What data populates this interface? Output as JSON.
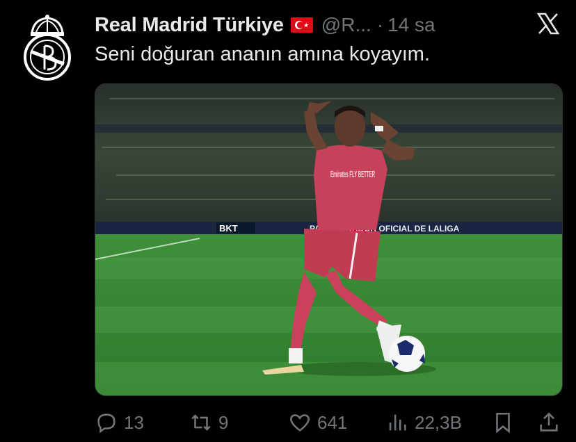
{
  "post": {
    "display_name": "Real Madrid Türkiye",
    "flag_icon": "turkey-flag-icon",
    "handle": "@R...",
    "separator": "·",
    "time": "14 sa",
    "text": "Seni doğuran ananın amına koyayım."
  },
  "media": {
    "type": "photo",
    "board_texts": {
      "left": "BKT",
      "right": "PATROCINADOR OFICIAL DE LALIGA"
    },
    "shirt_sponsor": "Emirates FLY BETTER"
  },
  "actions": {
    "replies": "13",
    "reposts": "9",
    "likes": "641",
    "views": "22,3B"
  },
  "colors": {
    "background": "#000000",
    "text_primary": "#e7e9ea",
    "text_secondary": "#71767b",
    "flag_red": "#e30a17"
  }
}
